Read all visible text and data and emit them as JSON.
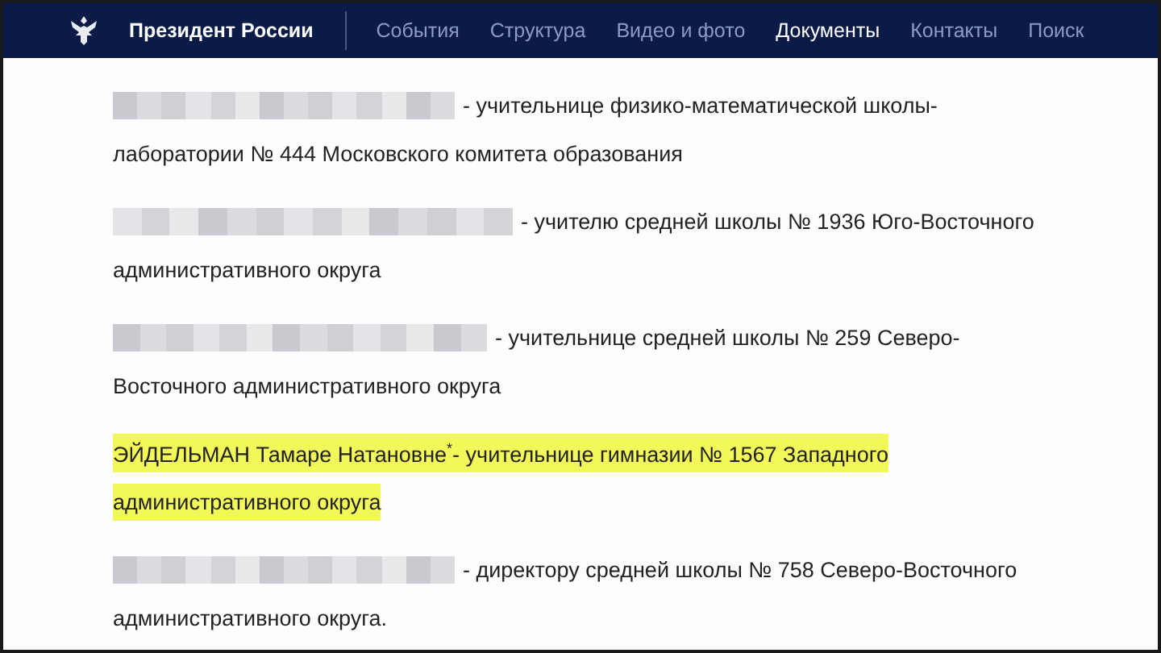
{
  "header": {
    "site_title": "Президент России",
    "nav": [
      {
        "label": "События",
        "selected": false
      },
      {
        "label": "Структура",
        "selected": false
      },
      {
        "label": "Видео и фото",
        "selected": false
      },
      {
        "label": "Документы",
        "selected": true
      },
      {
        "label": "Контакты",
        "selected": false
      },
      {
        "label": "Поиск",
        "selected": false
      }
    ]
  },
  "entries": [
    {
      "redacted": true,
      "highlighted": false,
      "lines": [
        "- учительнице физико-математической школы-",
        "лаборатории № 444 Московского комитета образования"
      ]
    },
    {
      "redacted": true,
      "highlighted": false,
      "lines": [
        "- учителю средней школы № 1936 Юго-Восточного",
        "административного округа"
      ]
    },
    {
      "redacted": true,
      "highlighted": false,
      "lines": [
        "- учительнице средней школы № 259 Северо-",
        "Восточного административного округа"
      ]
    },
    {
      "redacted": false,
      "highlighted": true,
      "lines": [
        "ЭЙДЕЛЬМАН Тамаре Натановне$^{*}$- учительнице гимназии № 1567 Западного",
        "административного округа"
      ]
    },
    {
      "redacted": true,
      "highlighted": false,
      "lines": [
        "- директору средней школы № 758 Северо-Восточного",
        "административного округа."
      ]
    }
  ]
}
